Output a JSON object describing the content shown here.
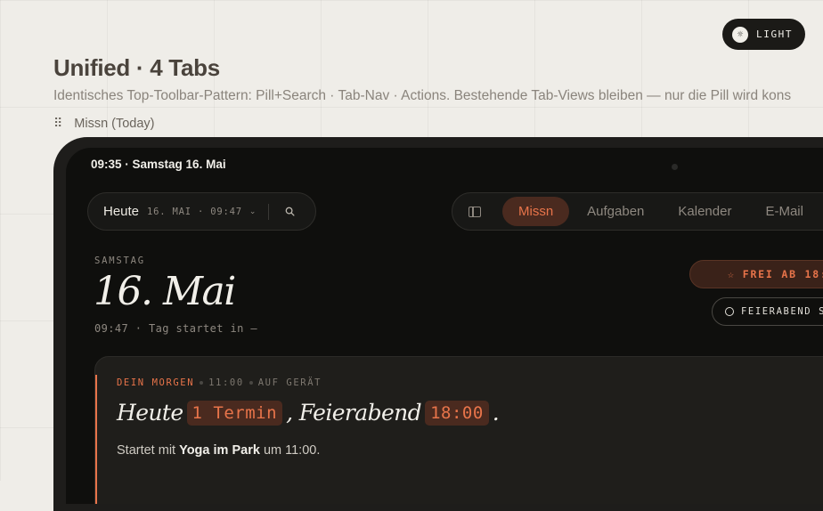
{
  "theme_toggle": {
    "label": "LIGHT",
    "icon": "sun-icon"
  },
  "page": {
    "title": "Unified · 4 Tabs",
    "subtitle": "Identisches Top-Toolbar-Pattern: Pill+Search · Tab-Nav · Actions. Bestehende Tab-Views bleiben — nur die Pill wird kons",
    "section_label": "Missn (Today)"
  },
  "device": {
    "status_time": "09:35 · Samstag 16. Mai",
    "search_pill": {
      "today_label": "Heute",
      "meta": "16. MAI · 09:47",
      "chevron_icon": "chevron-down-icon",
      "search_icon": "search-icon"
    },
    "tabs": [
      {
        "label": "Missn",
        "active": true
      },
      {
        "label": "Aufgaben",
        "active": false
      },
      {
        "label": "Kalender",
        "active": false
      },
      {
        "label": "E-Mail",
        "active": false
      }
    ],
    "day": {
      "weekday": "SAMSTAG",
      "date": "16. Mai",
      "subline": "09:47 · Tag startet in —"
    },
    "actions": {
      "frei_label": "FREI AB 18:",
      "feierabend_label": "FEIERABEND S"
    },
    "card": {
      "meta_label": "DEIN MORGEN",
      "meta_time": "11:00",
      "meta_device": "AUF GERÄT",
      "head_prefix": "Heute",
      "head_chip1": "1 Termin",
      "head_mid": ", Feierabend",
      "head_chip2": "18:00",
      "head_end": ".",
      "body_prefix": "Startet mit",
      "body_bold": "Yoga im Park",
      "body_suffix": "um 11:00."
    }
  },
  "colors": {
    "accent": "#e8744a",
    "background": "#efede8",
    "device_screen": "#0f0f0d"
  }
}
